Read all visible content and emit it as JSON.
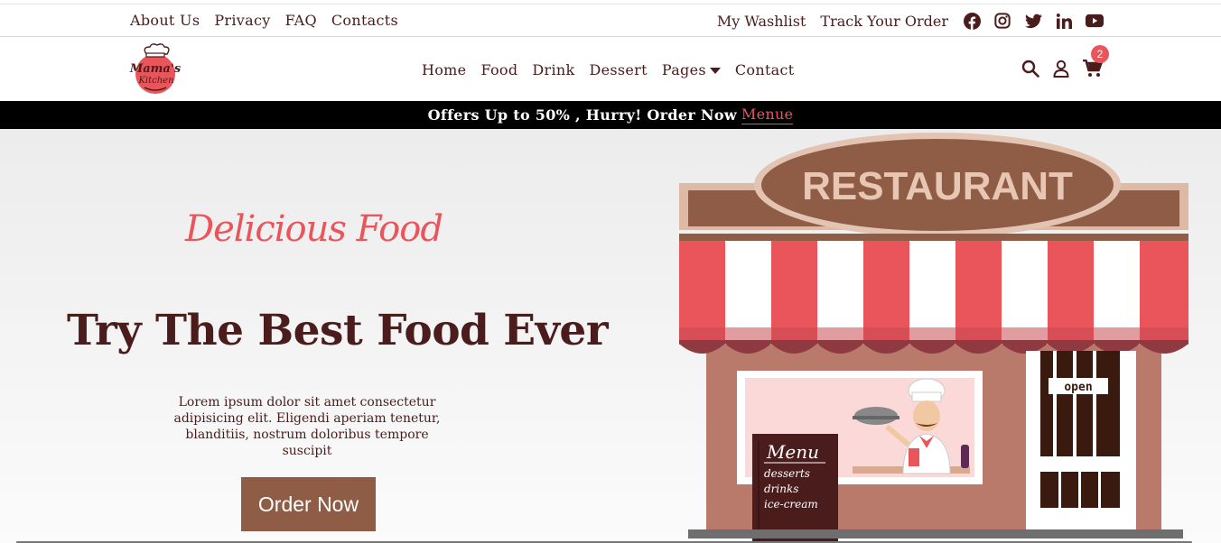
{
  "topbar": {
    "links": [
      "About Us",
      "Privacy",
      "FAQ",
      "Contacts"
    ],
    "wishlist": "My Washlist",
    "track": "Track Your Order",
    "social_icons": [
      "facebook-icon",
      "instagram-icon",
      "twitter-icon",
      "linkedin-icon",
      "youtube-icon"
    ]
  },
  "navbar": {
    "logo_text": "Mama's Kitchen",
    "menu": [
      "Home",
      "Food",
      "Drink",
      "Dessert",
      "Pages",
      "Contact"
    ],
    "cart_count": "2"
  },
  "offer": {
    "text": "Offers Up to 50% , Hurry! Order Now",
    "link": "Menue"
  },
  "hero": {
    "script_title": "Delicious Food",
    "headline": "Try The Best Food Ever",
    "description": "Lorem ipsum dolor sit amet consectetur adipisicing elit. Eligendi aperiam tenetur, blanditiis, nostrum doloribus tempore suscipit",
    "button": "Order Now"
  },
  "illustration": {
    "sign": "RESTAURANT",
    "door_sign": "open",
    "menu_board_title": "Menu",
    "menu_board_items": [
      "desserts",
      "drinks",
      "ice-cream"
    ]
  },
  "colors": {
    "brand_dark": "#4a1c1c",
    "accent": "#e9555b",
    "button": "#8f5c45"
  }
}
